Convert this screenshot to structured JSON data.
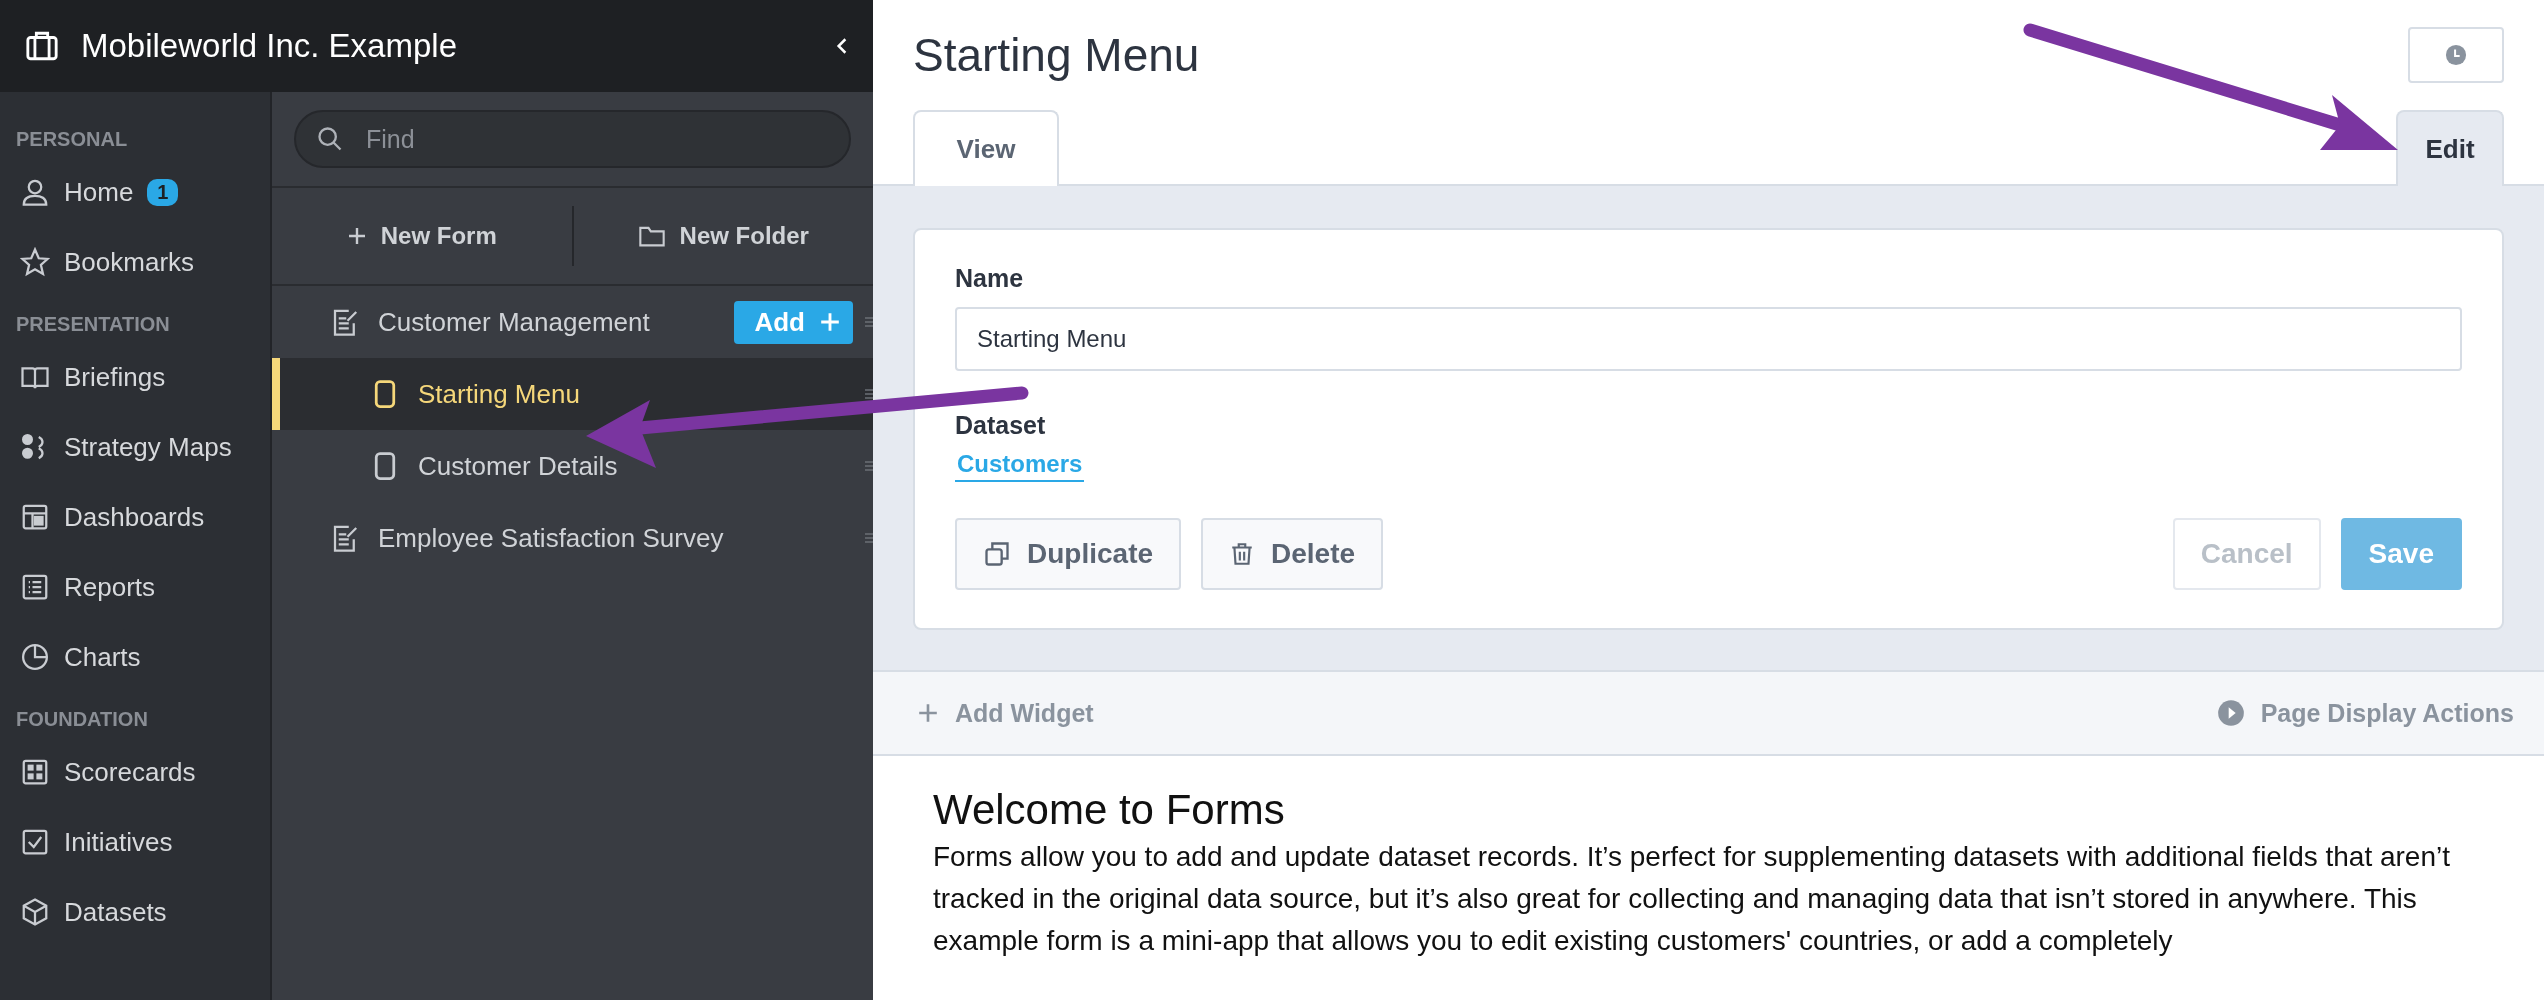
{
  "sidebar": {
    "title": "Mobileworld Inc. Example",
    "sections": [
      {
        "heading": "PERSONAL",
        "items": [
          {
            "kind": "user",
            "label": "Home",
            "badge": "1"
          },
          {
            "kind": "star",
            "label": "Bookmarks"
          }
        ]
      },
      {
        "heading": "PRESENTATION",
        "items": [
          {
            "kind": "book",
            "label": "Briefings"
          },
          {
            "kind": "map",
            "label": "Strategy Maps"
          },
          {
            "kind": "dashboard",
            "label": "Dashboards"
          },
          {
            "kind": "report",
            "label": "Reports"
          },
          {
            "kind": "pie",
            "label": "Charts"
          }
        ]
      },
      {
        "heading": "FOUNDATION",
        "items": [
          {
            "kind": "scorecard",
            "label": "Scorecards"
          },
          {
            "kind": "check",
            "label": "Initiatives"
          },
          {
            "kind": "cube",
            "label": "Datasets"
          }
        ]
      }
    ]
  },
  "tree": {
    "search": {
      "placeholder": "Find"
    },
    "toolbar": [
      "New Form",
      "New Folder"
    ],
    "items": [
      {
        "kind": "form",
        "label": "Customer Management",
        "selected": false,
        "action": "Add",
        "children": [
          {
            "kind": "page",
            "label": "Starting Menu",
            "selected": true
          },
          {
            "kind": "page",
            "label": "Customer Details",
            "selected": false
          }
        ]
      },
      {
        "kind": "form",
        "label": "Employee Satisfaction Survey",
        "selected": false
      }
    ]
  },
  "main": {
    "title": "Starting Menu",
    "tabs": [
      {
        "label": "View",
        "selected": false
      },
      {
        "label": "Edit",
        "selected": true
      }
    ],
    "form": {
      "name_label": "Name",
      "name_value": "Starting Menu",
      "dataset_label": "Dataset",
      "dataset_link": "Customers",
      "buttons": [
        {
          "kind": "duplicate",
          "label": "Duplicate",
          "disabled": false
        },
        {
          "kind": "delete",
          "label": "Delete",
          "disabled": false
        },
        {
          "kind": "cancel",
          "label": "Cancel",
          "disabled": true
        },
        {
          "kind": "save",
          "label": "Save",
          "disabled": true
        }
      ]
    },
    "widget_bar": {
      "add": "Add Widget",
      "actions": "Page Display Actions"
    },
    "content": {
      "heading": "Welcome to Forms",
      "paragraph": "Forms allow you to add and update dataset records. It’s perfect for supplementing datasets with additional fields that aren’t tracked in the original data source, but it’s also great for collecting and managing data that isn’t stored in anywhere. This example form is a mini-app that allows you to edit existing customers' countries, or add a completely"
    }
  }
}
